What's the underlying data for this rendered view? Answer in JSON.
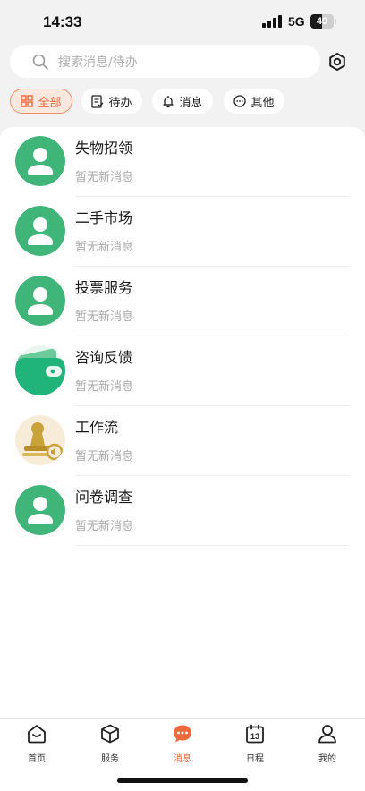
{
  "status_bar": {
    "time": "14:33",
    "network": "5G",
    "battery": "49",
    "battery_level": 0.49
  },
  "search": {
    "placeholder": "搜索消息/待办"
  },
  "filters": [
    {
      "label": "全部",
      "icon": "grid-icon",
      "active": true
    },
    {
      "label": "待办",
      "icon": "checklist-icon",
      "active": false
    },
    {
      "label": "消息",
      "icon": "bell-icon",
      "active": false
    },
    {
      "label": "其他",
      "icon": "more-circle-icon",
      "active": false
    }
  ],
  "list": [
    {
      "title": "失物招领",
      "subtitle": "暂无新消息",
      "icon": "user-avatar-icon"
    },
    {
      "title": "二手市场",
      "subtitle": "暂无新消息",
      "icon": "user-avatar-icon"
    },
    {
      "title": "投票服务",
      "subtitle": "暂无新消息",
      "icon": "user-avatar-icon"
    },
    {
      "title": "咨询反馈",
      "subtitle": "暂无新消息",
      "icon": "wallet-icon"
    },
    {
      "title": "工作流",
      "subtitle": "暂无新消息",
      "icon": "stamp-icon"
    },
    {
      "title": "问卷调查",
      "subtitle": "暂无新消息",
      "icon": "user-avatar-icon"
    }
  ],
  "tabbar": [
    {
      "label": "首页",
      "icon": "home-icon",
      "active": false
    },
    {
      "label": "服务",
      "icon": "cube-icon",
      "active": false
    },
    {
      "label": "消息",
      "icon": "chat-bubble-icon",
      "active": true
    },
    {
      "label": "日程",
      "icon": "calendar-icon",
      "active": false,
      "badge": "13"
    },
    {
      "label": "我的",
      "icon": "profile-icon",
      "active": false
    }
  ],
  "colors": {
    "accent": "#ee6a3c",
    "avatar_green": "#3fb57a",
    "background": "#f2f2f2"
  }
}
